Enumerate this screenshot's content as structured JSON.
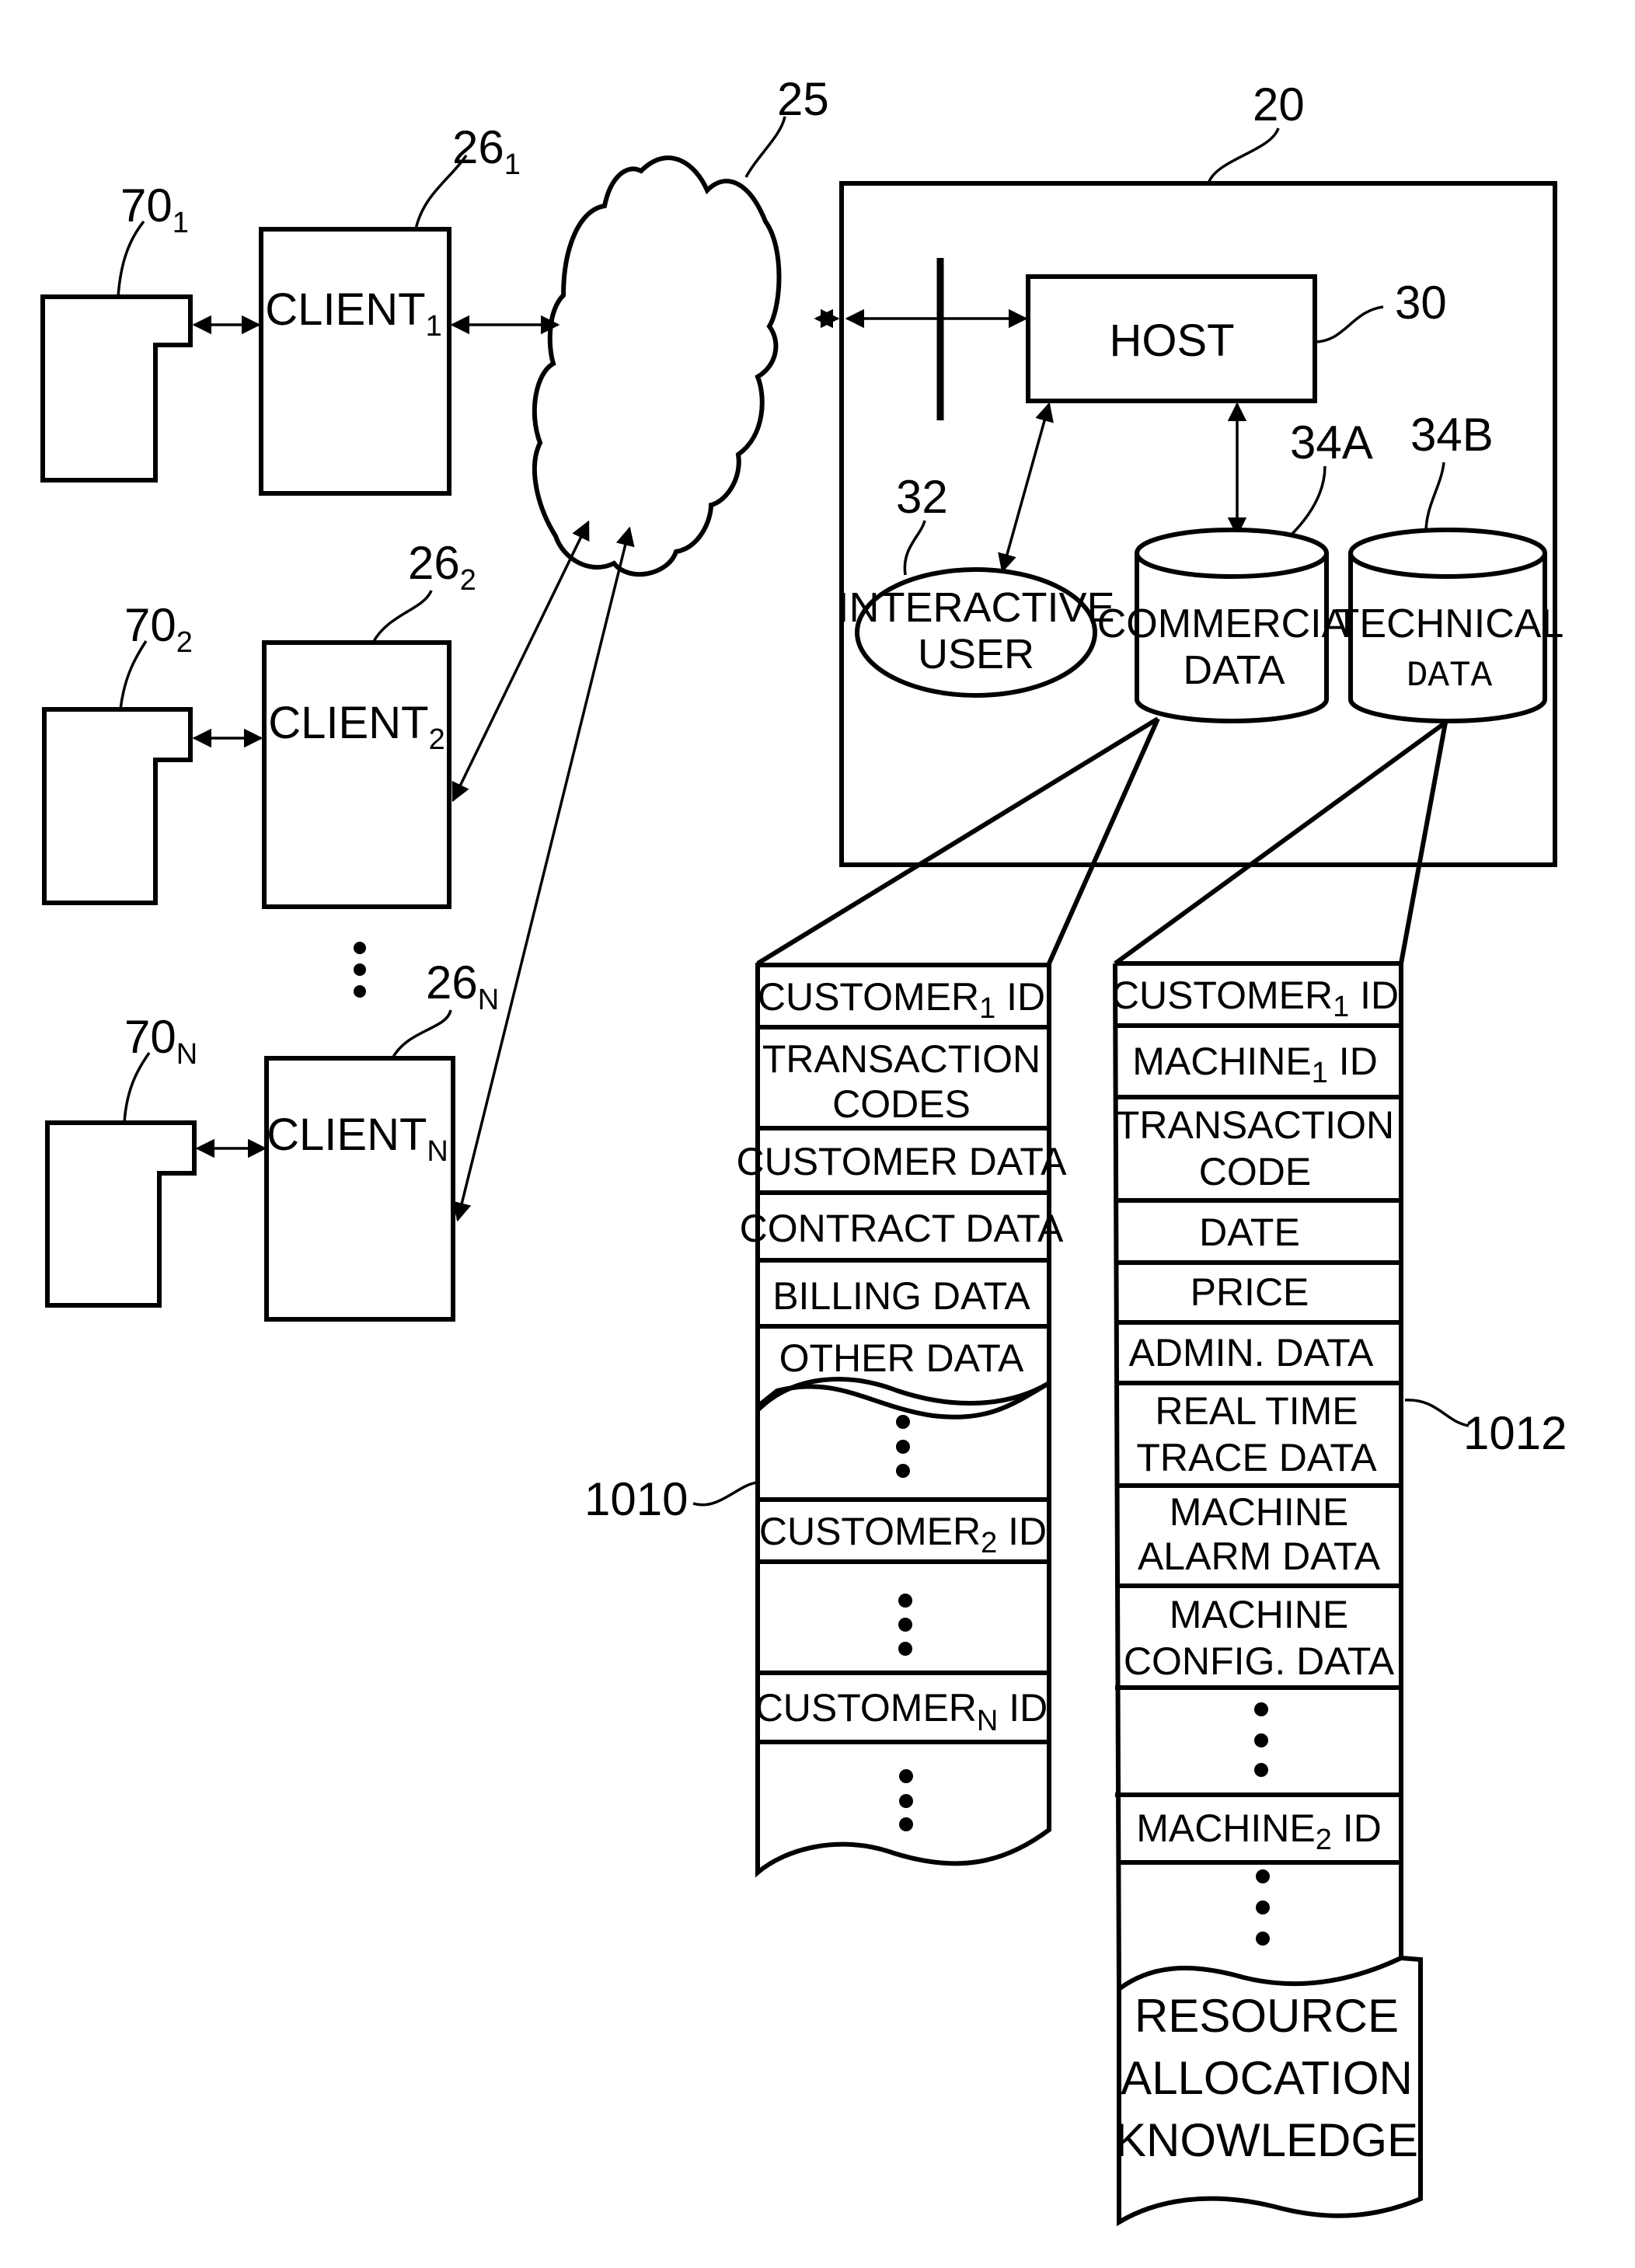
{
  "refs": {
    "system": "20",
    "network": "25",
    "host": "30",
    "interactive_user": "32",
    "commercial_db": "34A",
    "technical_db": "34B",
    "commercial_record": "1010",
    "technical_record": "1012",
    "client_1": {
      "base": "26",
      "sub": "1"
    },
    "client_2": {
      "base": "26",
      "sub": "2"
    },
    "client_n": {
      "base": "26",
      "sub": "N"
    },
    "device_1": {
      "base": "70",
      "sub": "1"
    },
    "device_2": {
      "base": "70",
      "sub": "2"
    },
    "device_n": {
      "base": "70",
      "sub": "N"
    }
  },
  "clients": [
    {
      "base": "CLIENT",
      "sub": "1"
    },
    {
      "base": "CLIENT",
      "sub": "2"
    },
    {
      "base": "CLIENT",
      "sub": "N"
    }
  ],
  "host": {
    "label": "HOST"
  },
  "interactive_user": {
    "line1": "INTERACTIVE",
    "line2": "USER"
  },
  "commercial_db": {
    "line1": "COMMERCIAL",
    "line2": "DATA"
  },
  "technical_db": {
    "line1": "TECHNICAL",
    "line2": "DATA"
  },
  "commercial_record": {
    "rows": [
      {
        "base": "CUSTOMER",
        "sub": "1",
        "tail": " ID"
      },
      {
        "line1": "TRANSACTION",
        "line2": "CODES"
      },
      {
        "text": "CUSTOMER DATA"
      },
      {
        "text": "CONTRACT DATA"
      },
      {
        "text": "BILLING DATA"
      },
      {
        "text": "OTHER DATA"
      },
      {
        "base": "CUSTOMER",
        "sub": "2",
        "tail": " ID"
      },
      {
        "base": "CUSTOMER",
        "sub": "N",
        "tail": " ID"
      }
    ]
  },
  "technical_record": {
    "rows": [
      {
        "base": "CUSTOMER",
        "sub": "1",
        "tail": " ID"
      },
      {
        "base": "MACHINE",
        "sub": "1",
        "tail": " ID"
      },
      {
        "line1": "TRANSACTION",
        "line2": "CODE"
      },
      {
        "text": "DATE"
      },
      {
        "text": "PRICE"
      },
      {
        "text": "ADMIN. DATA"
      },
      {
        "line1": "REAL TIME",
        "line2": "TRACE DATA"
      },
      {
        "line1": "MACHINE",
        "line2": "ALARM DATA"
      },
      {
        "line1": "MACHINE",
        "line2": "CONFIG. DATA"
      },
      {
        "base": "MACHINE",
        "sub": "2",
        "tail": " ID"
      },
      {
        "line1": "RESOURCE",
        "line2": "ALLOCATION",
        "line3": "KNOWLEDGE"
      }
    ]
  }
}
